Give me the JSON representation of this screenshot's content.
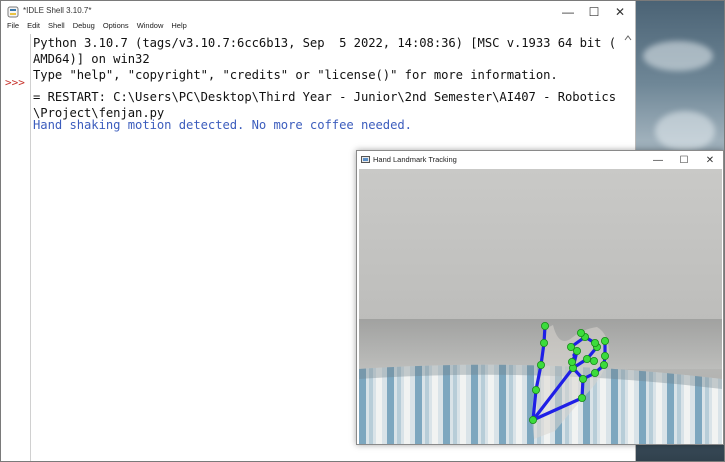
{
  "idle": {
    "title": "*IDLE Shell 3.10.7*",
    "menu": [
      "File",
      "Edit",
      "Shell",
      "Debug",
      "Options",
      "Window",
      "Help"
    ],
    "prompt": ">>>",
    "lines": [
      "Python 3.10.7 (tags/v3.10.7:6cc6b13, Sep  5 2022, 14:08:36) [MSC v.1933 64 bit (",
      "AMD64)] on win32",
      "Type \"help\", \"copyright\", \"credits\" or \"license()\" for more information.",
      "",
      "= RESTART: C:\\Users\\PC\\Desktop\\Third Year - Junior\\2nd Semester\\AI407 - Robotics",
      "\\Project\\fenjan.py",
      "Hand shaking motion detected. No more coffee needed."
    ]
  },
  "window_controls": {
    "minimize": "—",
    "maximize": "☐",
    "close": "✕"
  },
  "hand_window": {
    "title": "Hand Landmark Tracking"
  },
  "colors": {
    "prompt": "#c7342d",
    "output_blue": "#3c5dbd",
    "landmark": "#3cdc3c",
    "connection": "#1f1fe6"
  }
}
